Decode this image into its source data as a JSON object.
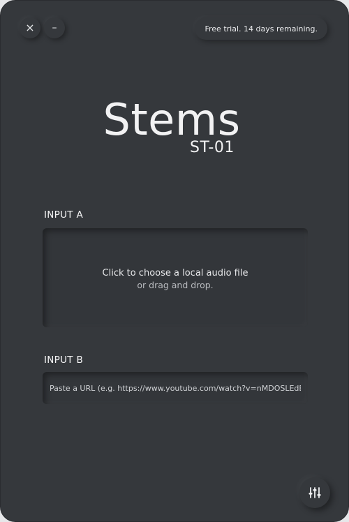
{
  "window": {
    "close_glyph": "×",
    "minimize_glyph": "–",
    "trial_text": "Free trial. 14 days remaining."
  },
  "logo": {
    "title": "Stems",
    "subtitle": "ST-01"
  },
  "input_a": {
    "label": "INPUT A",
    "primary_text": "Click to choose a local audio file",
    "secondary_text": "or drag and drop."
  },
  "input_b": {
    "label": "INPUT B",
    "placeholder": "Paste a URL (e.g. https://www.youtube.com/watch?v=nMDOSLEdBw)",
    "value": ""
  },
  "footer": {
    "settings_icon": "mixer-sliders-icon"
  },
  "colors": {
    "background": "#35383c",
    "text": "#f2f2f3"
  }
}
